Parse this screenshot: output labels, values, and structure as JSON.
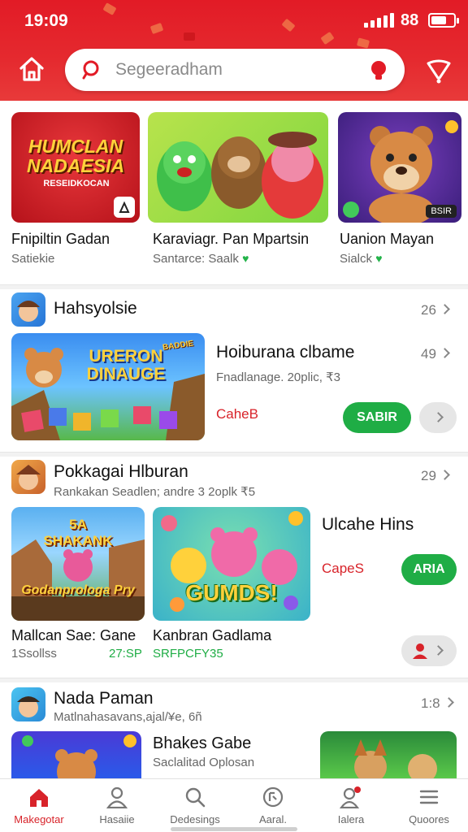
{
  "status_bar": {
    "time": "19:09",
    "battery": "88"
  },
  "search": {
    "placeholder": "Segeeradham"
  },
  "featured": [
    {
      "art_text_1": "HUMCLAN",
      "art_text_2": "NADAESIA",
      "art_text_3": "RESEIDKOCAN",
      "title": "Fnipiltin Gadan",
      "subtitle": "Satiekie"
    },
    {
      "title": "Karaviagr. Pan Mpartsin",
      "subtitle": "Santarce: Saalk"
    },
    {
      "badge": "BSIR",
      "title": "Uanion Mayan",
      "subtitle": "Sialck"
    }
  ],
  "section1": {
    "title": "Hahsyolsie",
    "count": "26",
    "app": {
      "art_title_1": "URERON",
      "art_title_2": "DINAUGE",
      "art_corner": "BADDIE",
      "name": "Hoiburana clbame",
      "meta": "Fnadlanage. 20plic, ₹3",
      "count": "49",
      "link": "CaheB",
      "button": "SABIR"
    }
  },
  "section2": {
    "title": "Pokkagai Hlburan",
    "subtitle": "Rankakan Seadlen; andre 3 2oplk ₹5",
    "count": "29",
    "games": [
      {
        "art_top": "5A SHAKANK",
        "art_bottom": "Godanprologa Pry",
        "title": "Mallcan Sae: Gane",
        "sub_left": "1Ssollss",
        "sub_right": "27:SP"
      },
      {
        "art": "GUMDS!",
        "title": "Kanbran Gadlama",
        "sub": "SRFPCFY35"
      }
    ],
    "side_title": "Ulcahe Hins",
    "side_link": "CapeS",
    "side_button": "ARIA"
  },
  "section3": {
    "title": "Nada Paman",
    "subtitle": "Matlnahasavans,ajal/¥e, 6ñ",
    "count": "1:8",
    "app_name": "Bhakes Gabe",
    "app_meta": "Saclalitad Oplosan"
  },
  "bottom_nav": [
    {
      "label": "Makegotar",
      "icon": "home-icon"
    },
    {
      "label": "Hasaiie",
      "icon": "person-icon"
    },
    {
      "label": "Dedesings",
      "icon": "search-icon"
    },
    {
      "label": "Aaral.",
      "icon": "refresh-icon"
    },
    {
      "label": "Ialera",
      "icon": "notification-person-icon"
    },
    {
      "label": "Quoores",
      "icon": "menu-icon"
    }
  ],
  "colors": {
    "brand_red": "#e21b26",
    "accent_green": "#1fad45",
    "link_red": "#d8232a"
  }
}
